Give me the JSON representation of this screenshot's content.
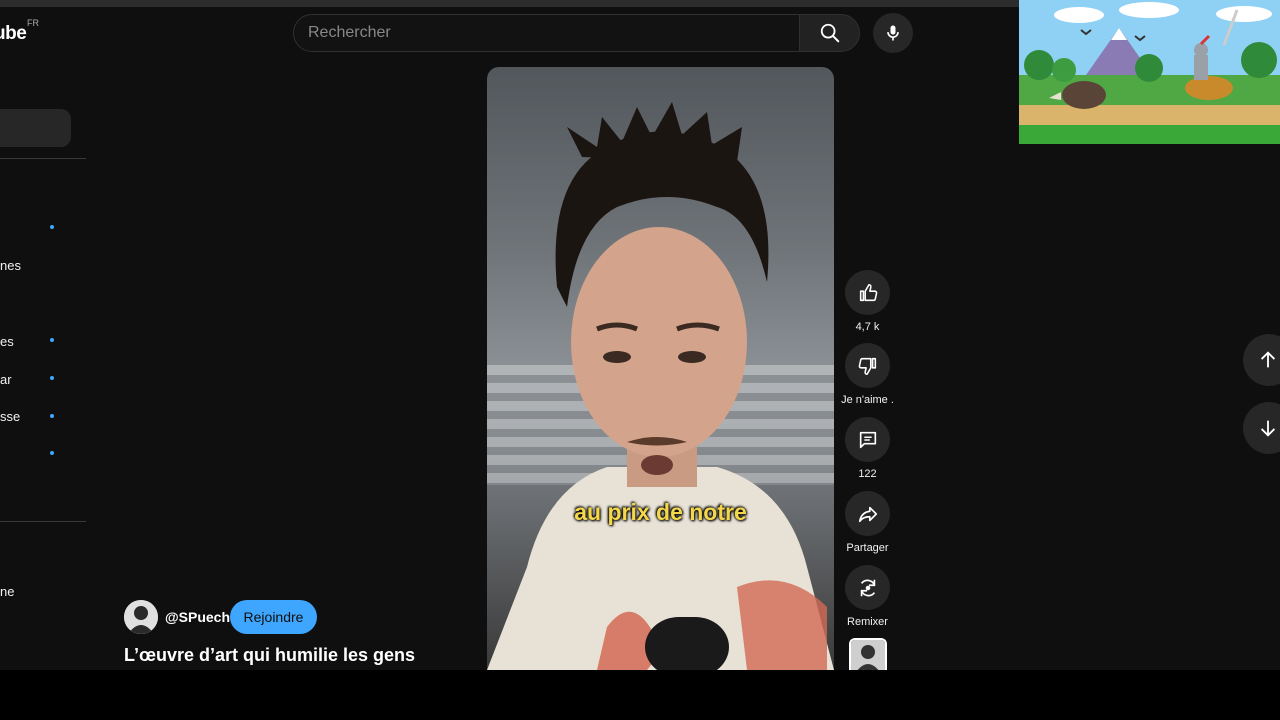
{
  "app": {
    "logo_text": "ube",
    "logo_country": "FR"
  },
  "search": {
    "placeholder": "Rechercher"
  },
  "sidebar": {
    "labels": [
      "nes",
      "es",
      "ar",
      "sse",
      "ne"
    ]
  },
  "video": {
    "subtitle": "au prix de notre"
  },
  "actions": {
    "like_count": "4,7 k",
    "dislike_label": "Je n'aime .",
    "comment_count": "122",
    "share_label": "Partager",
    "remix_label": "Remixer"
  },
  "channel": {
    "handle": "@SPuech",
    "join_label": "Rejoindre"
  },
  "short_title": "L’œuvre d’art qui humilie les gens",
  "colors": {
    "accent": "#3ea6ff",
    "subtitle": "#f5d84a",
    "background": "#0f0f0f",
    "button_bg": "#272727"
  },
  "icons": [
    "search-icon",
    "mic-icon",
    "thumb-up-icon",
    "thumb-down-icon",
    "comment-icon",
    "share-icon",
    "remix-icon",
    "arrow-up-icon",
    "arrow-down-icon",
    "chevron-right-icon"
  ]
}
